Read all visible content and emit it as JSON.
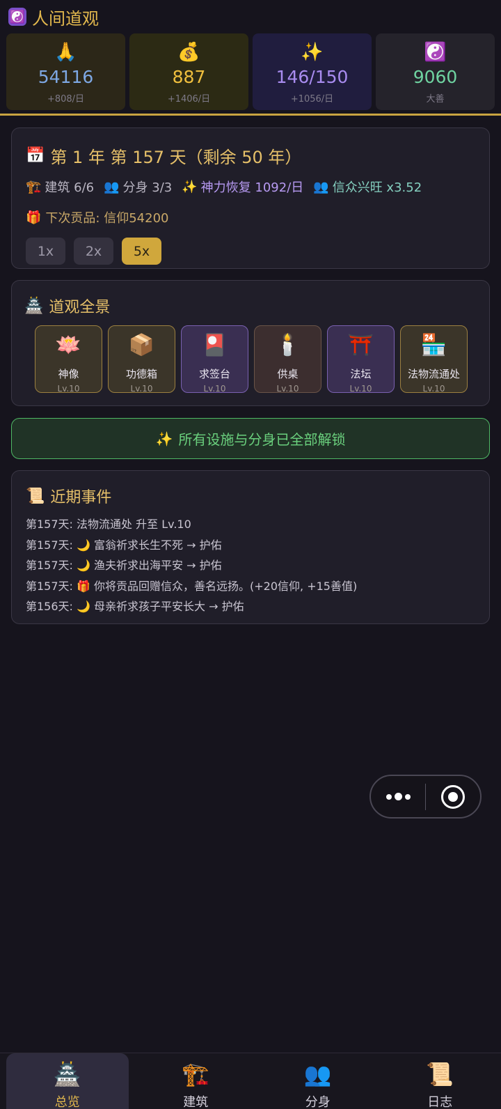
{
  "header": {
    "logo_icon": "☯️",
    "title": "人间道观"
  },
  "stats": [
    {
      "key": "faith",
      "icon": "🙏",
      "value": "54116",
      "sub": "+808/日"
    },
    {
      "key": "money",
      "icon": "💰",
      "value": "887",
      "sub": "+1406/日"
    },
    {
      "key": "spirit",
      "icon": "✨",
      "value": "146/150",
      "sub": "+1056/日"
    },
    {
      "key": "virtue",
      "icon": "☯️",
      "value": "9060",
      "sub": "大善"
    }
  ],
  "time": {
    "icon": "📅",
    "date": "第 1 年  第 157 天（剩余 50 年）",
    "buildings_icon": "🏗️",
    "buildings": "建筑 6/6",
    "avatars_icon": "👥",
    "avatars": "分身 3/3",
    "recover_icon": "✨",
    "recover": "神力恢复 1092/日",
    "followers_icon": "👥",
    "followers": "信众兴旺 x3.52",
    "gift_icon": "🎁",
    "next_gift": "下次贡品: 信仰54200",
    "speeds": [
      "1x",
      "2x",
      "5x"
    ],
    "active_speed": "5x"
  },
  "panorama": {
    "icon": "🏯",
    "title": "道观全景",
    "buildings": [
      {
        "icon": "🪷",
        "name": "神像",
        "level": "Lv.10"
      },
      {
        "icon": "📦",
        "name": "功德箱",
        "level": "Lv.10"
      },
      {
        "icon": "🎴",
        "name": "求签台",
        "level": "Lv.10"
      },
      {
        "icon": "🕯️",
        "name": "供桌",
        "level": "Lv.10"
      },
      {
        "icon": "⛩️",
        "name": "法坛",
        "level": "Lv.10"
      },
      {
        "icon": "🏪",
        "name": "法物流通处",
        "level": "Lv.10"
      }
    ]
  },
  "unlock": {
    "icon": "✨",
    "text": "所有设施与分身已全部解锁"
  },
  "events": {
    "icon": "📜",
    "title": "近期事件",
    "items": [
      "第157天: 法物流通处 升至 Lv.10",
      "第157天: 🌙 富翁祈求长生不死 → 护佑",
      "第157天: 🌙 渔夫祈求出海平安 → 护佑",
      "第157天: 🎁 你将贡品回赠信众，善名远扬。(+20信仰, +15善值)",
      "第156天: 🌙 母亲祈求孩子平安长大 → 护佑"
    ]
  },
  "capsule": {
    "more_icon": "more-dots-icon",
    "close_icon": "record-circle-icon"
  },
  "tabs": [
    {
      "icon": "🏯",
      "label": "总览"
    },
    {
      "icon": "🏗️",
      "label": "建筑"
    },
    {
      "icon": "👥",
      "label": "分身"
    },
    {
      "icon": "📜",
      "label": "日志"
    }
  ],
  "active_tab": "总览"
}
